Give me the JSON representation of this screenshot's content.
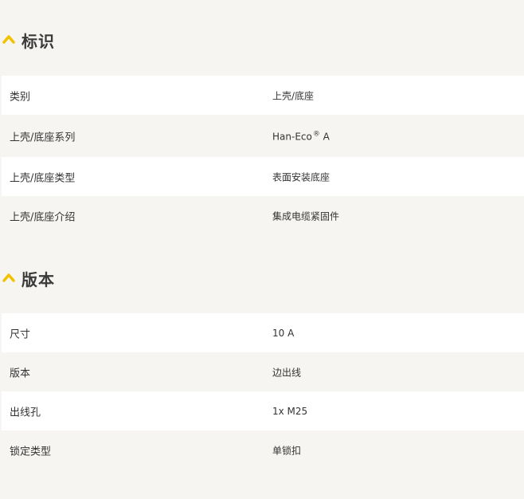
{
  "sections": [
    {
      "title": "标识",
      "rows": [
        {
          "label": "类别",
          "value": "上壳/底座"
        },
        {
          "label": "上壳/底座系列",
          "value": "Han-Eco",
          "value_sup": "®",
          "value_suffix": " A"
        },
        {
          "label": "上壳/底座类型",
          "value": "表面安装底座"
        },
        {
          "label": "上壳/底座介绍",
          "value": "集成电缆紧固件"
        }
      ]
    },
    {
      "title": "版本",
      "rows": [
        {
          "label": "尺寸",
          "value": "10 A"
        },
        {
          "label": "版本",
          "value": "边出线"
        },
        {
          "label": "出线孔",
          "value": "1x M25"
        },
        {
          "label": "锁定类型",
          "value": "单锁扣"
        }
      ]
    }
  ],
  "icons": {
    "section_toggle": "chevron-up-icon"
  },
  "colors": {
    "accent": "#f2c200",
    "page_background": "#f6f5f2",
    "row_white": "#ffffff",
    "text": "#333333"
  }
}
